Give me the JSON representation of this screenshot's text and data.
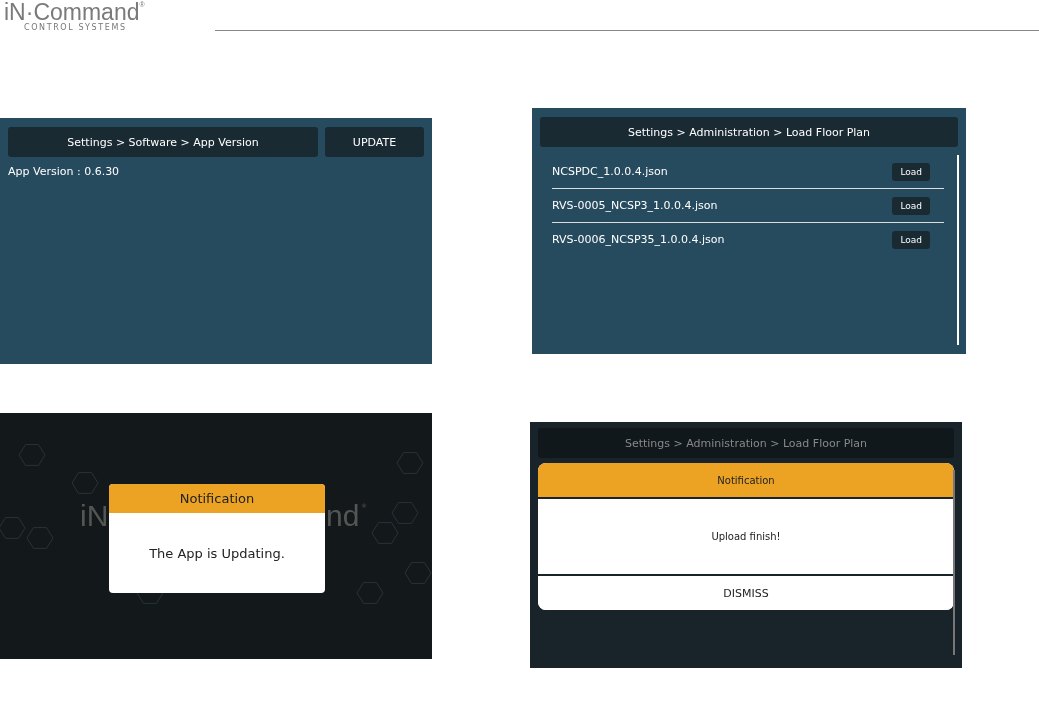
{
  "header": {
    "logo": {
      "brand": "iN·Command",
      "registered": "®",
      "tagline": "CONTROL SYSTEMS"
    }
  },
  "screens": [
    {
      "kind": "version",
      "breadcrumb": "Settings > Software > App Version",
      "button": "UPDATE",
      "info": "App Version : 0.6.30"
    },
    {
      "kind": "files",
      "breadcrumb": "Settings > Administration > Load Floor Plan",
      "files": [
        {
          "name": "NCSPDC_1.0.0.4.json",
          "button": "Load"
        },
        {
          "name": "RVS-0005_NCSP3_1.0.0.4.json",
          "button": "Load"
        },
        {
          "name": "RVS-0006_NCSP35_1.0.0.4.json",
          "button": "Load"
        }
      ]
    },
    {
      "kind": "splash",
      "background_logo": {
        "left": "iN",
        "right": "nd",
        "registered": "®"
      },
      "dialog": {
        "title": "Notification",
        "message": "The App is Updating."
      }
    },
    {
      "kind": "notice",
      "breadcrumb": "Settings > Administration > Load Floor Plan",
      "dialog": {
        "title": "Notification",
        "message": "Upload finish!",
        "button": "DISMISS"
      }
    }
  ]
}
